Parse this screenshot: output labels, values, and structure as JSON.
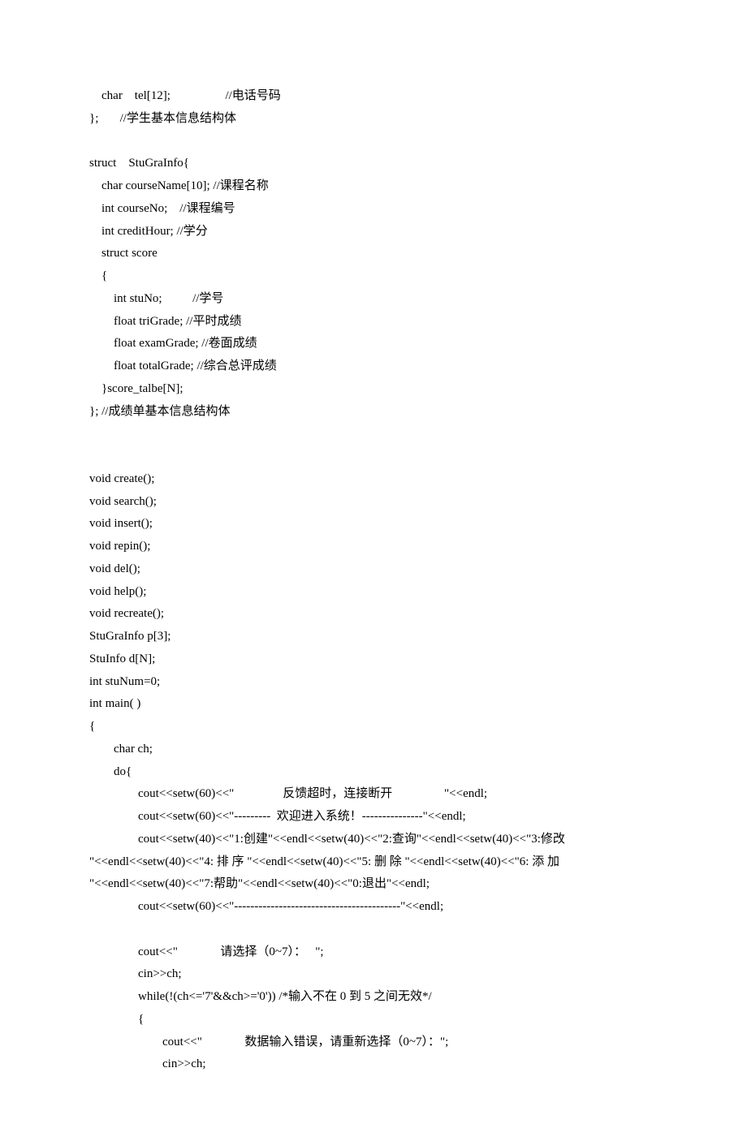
{
  "lines": [
    "    char    tel[12];                  //电话号码",
    "};       //学生基本信息结构体",
    "",
    "struct    StuGraInfo{",
    "    char courseName[10]; //课程名称",
    "    int courseNo;    //课程编号",
    "    int creditHour; //学分",
    "    struct score",
    "    {",
    "        int stuNo;          //学号",
    "        float triGrade; //平时成绩",
    "        float examGrade; //卷面成绩",
    "        float totalGrade; //综合总评成绩",
    "    }score_talbe[N];",
    "}; //成绩单基本信息结构体",
    "",
    "",
    "void create();",
    "void search();",
    "void insert();",
    "void repin();",
    "void del();",
    "void help();",
    "void recreate();",
    "StuGraInfo p[3];",
    "StuInfo d[N];",
    "int stuNum=0;",
    "int main( )",
    "{",
    "        char ch;",
    "        do{",
    "                cout<<setw(60)<<\"                反馈超时，连接断开                 \"<<endl;",
    "                cout<<setw(60)<<\"---------  欢迎进入系统！---------------\"<<endl;",
    "                cout<<setw(40)<<\"1:创建\"<<endl<<setw(40)<<\"2:查询\"<<endl<<setw(40)<<\"3:修改",
    "\"<<endl<<setw(40)<<\"4: 排 序 \"<<endl<<setw(40)<<\"5: 删 除 \"<<endl<<setw(40)<<\"6: 添 加",
    "\"<<endl<<setw(40)<<\"7:帮助\"<<endl<<setw(40)<<\"0:退出\"<<endl;",
    "                cout<<setw(60)<<\"-----------------------------------------\"<<endl;",
    "",
    "                cout<<\"              请选择（0~7）：   \";",
    "                cin>>ch;",
    "                while(!(ch<='7'&&ch>='0')) /*输入不在 0 到 5 之间无效*/",
    "                {",
    "                        cout<<\"              数据输入错误，请重新选择（0~7）：\";",
    "                        cin>>ch;"
  ]
}
